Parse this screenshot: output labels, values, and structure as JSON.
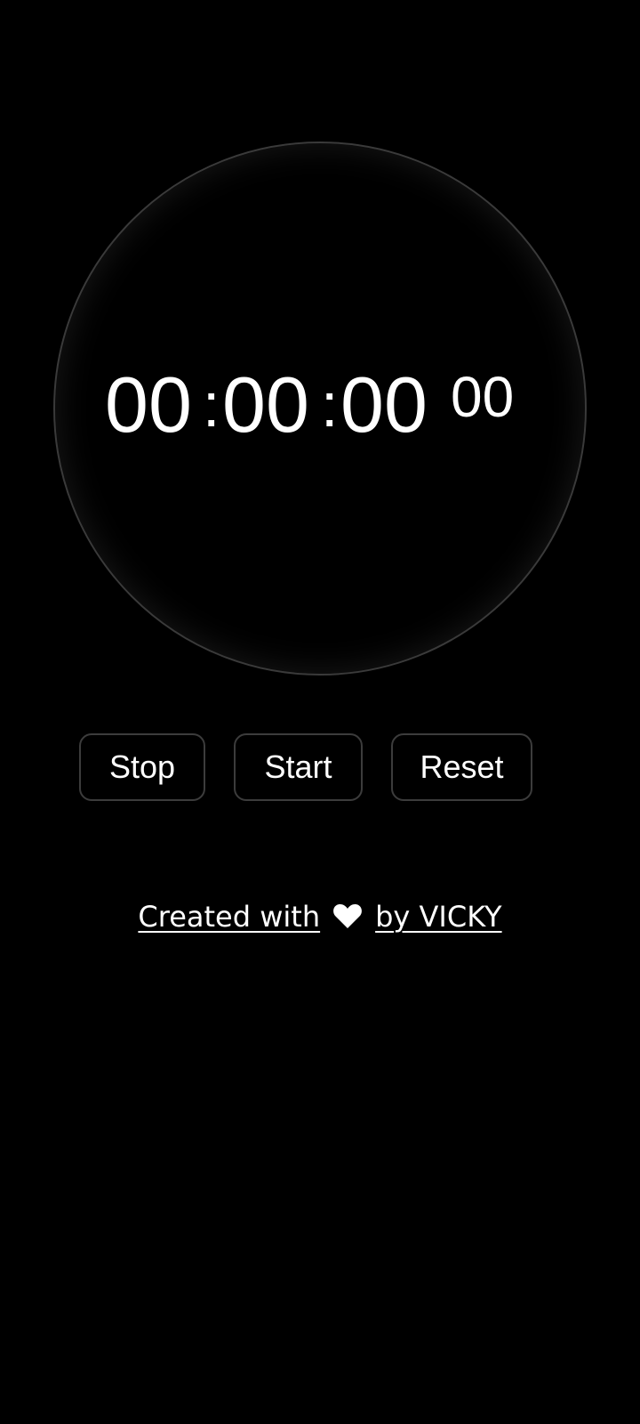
{
  "stopwatch": {
    "hours": "00",
    "minutes": "00",
    "seconds": "00",
    "centiseconds": "00",
    "separator": ":"
  },
  "buttons": {
    "stop_label": "Stop",
    "start_label": "Start",
    "reset_label": "Reset"
  },
  "footer": {
    "created_with": "Created with",
    "by_author": "by VICKY",
    "icon": "heart-icon"
  },
  "colors": {
    "background": "#000000",
    "text": "#ffffff",
    "border": "#3c3c3c"
  }
}
